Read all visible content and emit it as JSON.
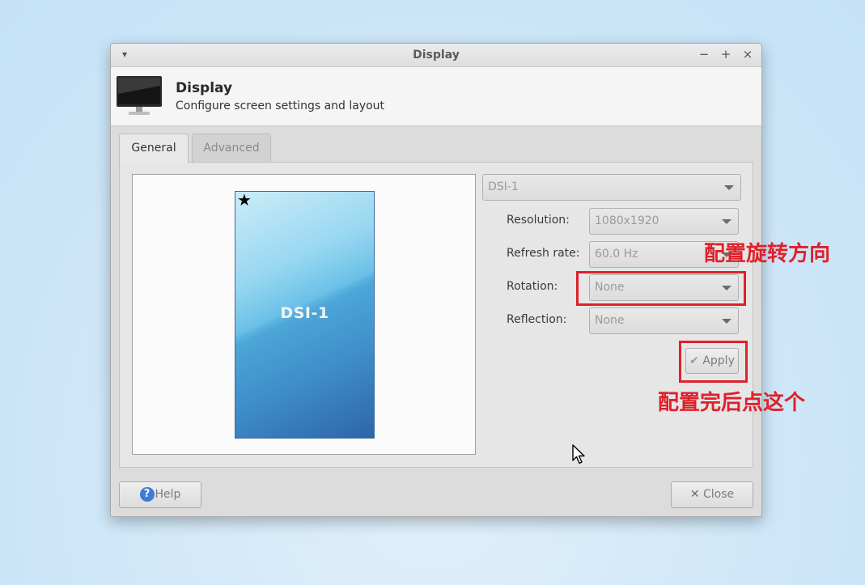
{
  "window": {
    "title": "Display",
    "menu_glyph": "▾",
    "controls": {
      "minimize": "−",
      "maximize": "+",
      "close": "×"
    }
  },
  "header": {
    "icon": "monitor-icon",
    "title": "Display",
    "subtitle": "Configure screen settings and layout"
  },
  "tabs": [
    {
      "label": "General",
      "active": true
    },
    {
      "label": "Advanced",
      "active": false
    }
  ],
  "preview": {
    "screen_label": "DSI-1",
    "primary_marker": "★"
  },
  "settings": {
    "display_select": "DSI-1",
    "resolution": {
      "label": "Resolution:",
      "value": "1080x1920"
    },
    "refresh_rate": {
      "label": "Refresh rate:",
      "value": "60.0 Hz"
    },
    "rotation": {
      "label": "Rotation:",
      "value": "None"
    },
    "reflection": {
      "label": "Reflection:",
      "value": "None"
    }
  },
  "apply_button": {
    "icon": "✔",
    "label": "Apply"
  },
  "footer": {
    "help": {
      "icon": "?",
      "label": "Help"
    },
    "close": {
      "icon": "✕",
      "label": "Close"
    }
  },
  "annotations": {
    "rotation_note": "配置旋转方向",
    "apply_note": "配置完后点这个",
    "color": "#e0202a"
  }
}
